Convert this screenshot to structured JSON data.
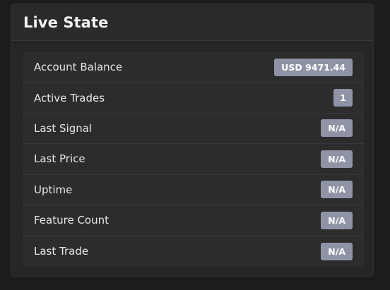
{
  "card": {
    "title": "Live State"
  },
  "rows": [
    {
      "label": "Account Balance",
      "value": "USD 9471.44"
    },
    {
      "label": "Active Trades",
      "value": "1"
    },
    {
      "label": "Last Signal",
      "value": "N/A"
    },
    {
      "label": "Last Price",
      "value": "N/A"
    },
    {
      "label": "Uptime",
      "value": "N/A"
    },
    {
      "label": "Feature Count",
      "value": "N/A"
    },
    {
      "label": "Last Trade",
      "value": "N/A"
    }
  ],
  "colors": {
    "background": "#1c1c1d",
    "card": "#262627",
    "badge": "#8f93a5"
  }
}
